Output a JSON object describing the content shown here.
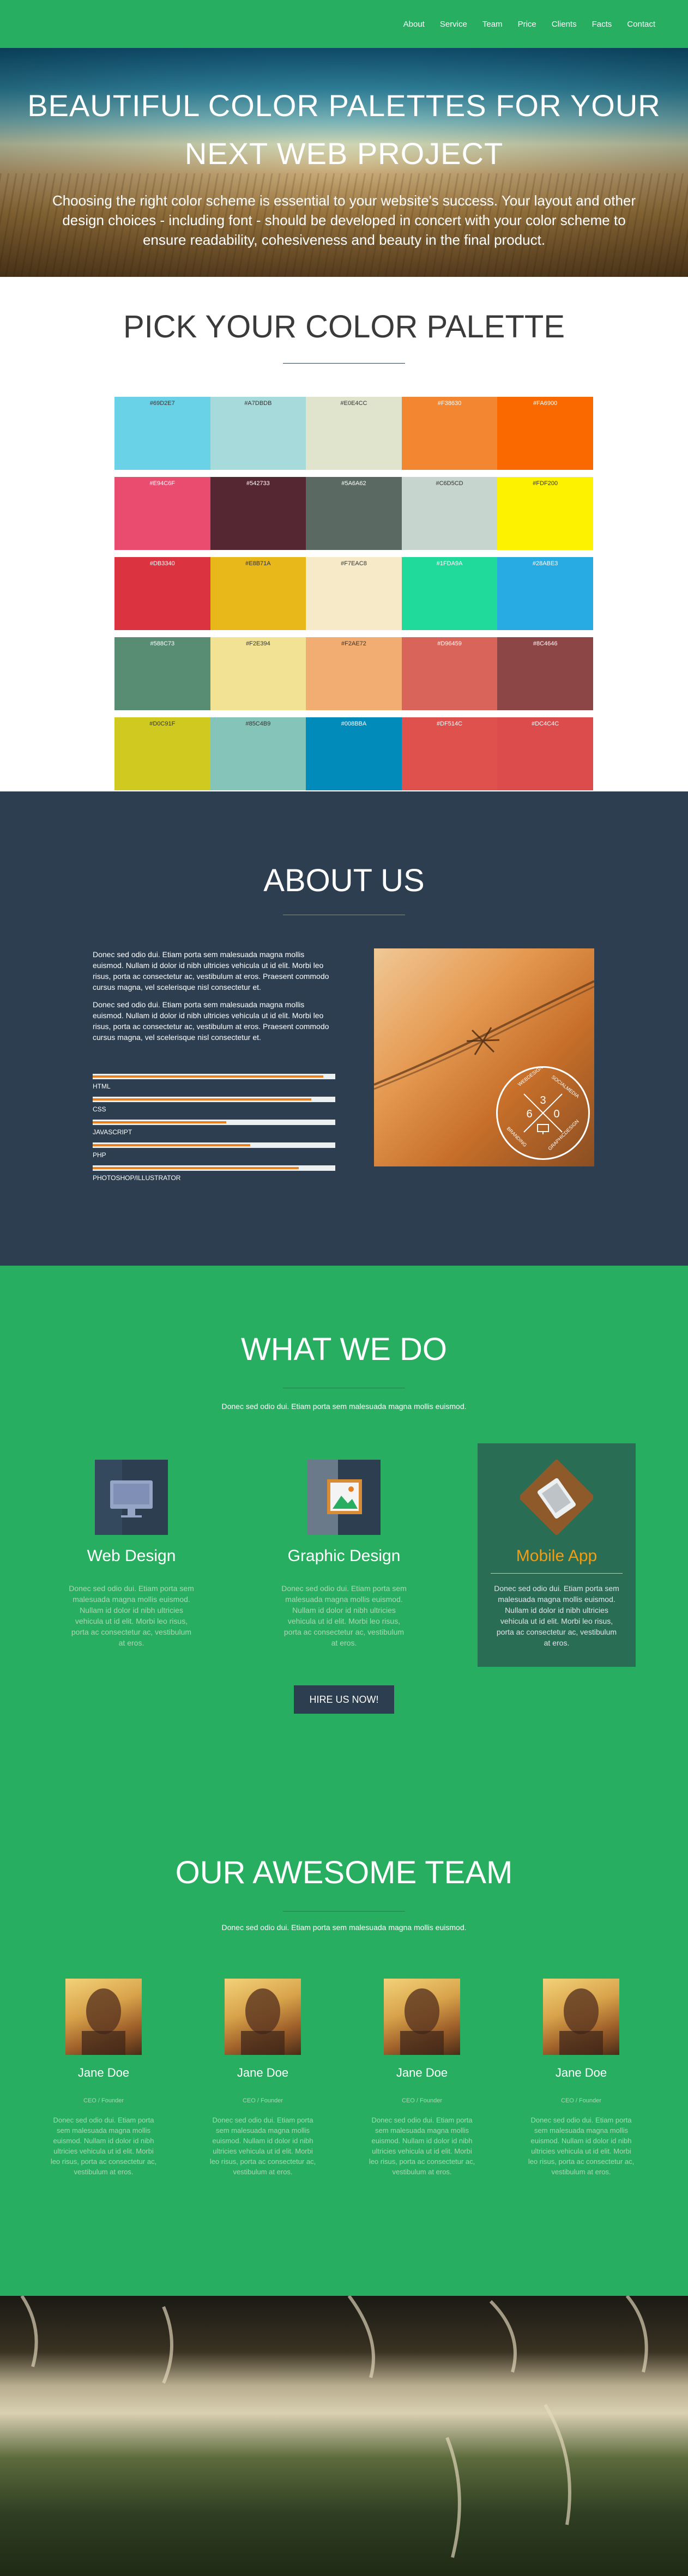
{
  "nav": {
    "items": [
      "About",
      "Service",
      "Team",
      "Price",
      "Clients",
      "Facts",
      "Contact"
    ]
  },
  "hero": {
    "title": "BEAUTIFUL COLOR PALETTES FOR YOUR NEXT WEB PROJECT",
    "text": "Choosing the right color scheme is essential to your website's success. Your layout and other design choices - including font - should be developed in concert with your color scheme to ensure readability, cohesiveness and beauty in the final product."
  },
  "palette": {
    "title": "PICK YOUR COLOR PALETTE",
    "rows": [
      [
        {
          "hex": "#69D2E7"
        },
        {
          "hex": "#A7DBDB"
        },
        {
          "hex": "#E0E4CC"
        },
        {
          "hex": "#F38630"
        },
        {
          "hex": "#FA6900"
        }
      ],
      [
        {
          "hex": "#E94C6F"
        },
        {
          "hex": "#542733"
        },
        {
          "hex": "#5A6A62"
        },
        {
          "hex": "#C6D5CD"
        },
        {
          "hex": "#FDF200"
        }
      ],
      [
        {
          "hex": "#DB3340"
        },
        {
          "hex": "#E8B71A"
        },
        {
          "hex": "#F7EAC8"
        },
        {
          "hex": "#1FDA9A"
        },
        {
          "hex": "#28ABE3"
        }
      ],
      [
        {
          "hex": "#588C73"
        },
        {
          "hex": "#F2E394"
        },
        {
          "hex": "#F2AE72"
        },
        {
          "hex": "#D96459"
        },
        {
          "hex": "#8C4646"
        }
      ],
      [
        {
          "hex": "#D0C91F"
        },
        {
          "hex": "#85C4B9"
        },
        {
          "hex": "#008BBA"
        },
        {
          "hex": "#DF514C"
        },
        {
          "hex": "#DC4C4C"
        }
      ]
    ]
  },
  "about": {
    "title": "ABOUT US",
    "paragraphs": [
      "Donec sed odio dui. Etiam porta sem malesuada magna mollis euismod. Nullam id dolor id nibh ultricies vehicula ut id elit. Morbi leo risus, porta ac consectetur ac, vestibulum at eros. Praesent commodo cursus magna, vel scelerisque nisl consectetur et.",
      "Donec sed odio dui. Etiam porta sem malesuada magna mollis euismod. Nullam id dolor id nibh ultricies vehicula ut id elit. Morbi leo risus, porta ac consectetur ac, vestibulum at eros. Praesent commodo cursus magna, vel scelerisque nisl consectetur et."
    ],
    "skills": [
      {
        "label": "HTML",
        "percent": 95
      },
      {
        "label": "CSS",
        "percent": 90
      },
      {
        "label": "JAVASCRIPT",
        "percent": 55
      },
      {
        "label": "PHP",
        "percent": 65
      },
      {
        "label": "PHOTOSHOP/ILLUSTRATOR",
        "percent": 85
      }
    ],
    "badge": {
      "top_left": "WEBDESIGN",
      "top_right": "SOCIALMEDIA",
      "bottom_left": "BRANDING",
      "bottom_right": "GRAPHICDESIGN",
      "digits": [
        "3",
        "6",
        "0"
      ]
    }
  },
  "services": {
    "title": "WHAT WE DO",
    "tagline": "Donec sed odio dui. Etiam porta sem malesuada magna mollis euismod.",
    "items": [
      {
        "title": "Web Design",
        "icon": "monitor-icon",
        "text": "Donec sed odio dui. Etiam porta sem malesuada magna mollis euismod. Nullam id dolor id nibh ultricies vehicula ut id elit. Morbi leo risus, porta ac consectetur ac, vestibulum at eros."
      },
      {
        "title": "Graphic Design",
        "icon": "picture-icon",
        "text": "Donec sed odio dui. Etiam porta sem malesuada magna mollis euismod. Nullam id dolor id nibh ultricies vehicula ut id elit. Morbi leo risus, porta ac consectetur ac, vestibulum at eros."
      },
      {
        "title": "Mobile App",
        "icon": "tablet-icon",
        "text": "Donec sed odio dui. Etiam porta sem malesuada magna mollis euismod. Nullam id dolor id nibh ultricies vehicula ut id elit. Morbi leo risus, porta ac consectetur ac, vestibulum at eros."
      }
    ],
    "hire_label": "HIRE US NOW!"
  },
  "team": {
    "title": "OUR AWESOME TEAM",
    "tagline": "Donec sed odio dui. Etiam porta sem malesuada magna mollis euismod.",
    "members": [
      {
        "name": "Jane Doe",
        "role": "CEO / Founder",
        "text": "Donec sed odio dui. Etiam porta sem malesuada magna mollis euismod. Nullam id dolor id nibh ultricies vehicula ut id elit. Morbi leo risus, porta ac consectetur ac, vestibulum at eros."
      },
      {
        "name": "Jane Doe",
        "role": "CEO / Founder",
        "text": "Donec sed odio dui. Etiam porta sem malesuada magna mollis euismod. Nullam id dolor id nibh ultricies vehicula ut id elit. Morbi leo risus, porta ac consectetur ac, vestibulum at eros."
      },
      {
        "name": "Jane Doe",
        "role": "CEO / Founder",
        "text": "Donec sed odio dui. Etiam porta sem malesuada magna mollis euismod. Nullam id dolor id nibh ultricies vehicula ut id elit. Morbi leo risus, porta ac consectetur ac, vestibulum at eros."
      },
      {
        "name": "Jane Doe",
        "role": "CEO / Founder",
        "text": "Donec sed odio dui. Etiam porta sem malesuada magna mollis euismod. Nullam id dolor id nibh ultricies vehicula ut id elit. Morbi leo risus, porta ac consectetur ac, vestibulum at eros."
      }
    ]
  },
  "colors": {
    "green": "#27AE60",
    "navy": "#2C3E50",
    "orange": "#E67E22",
    "active_card": "#2A6D55",
    "active_title": "#F39C12"
  }
}
